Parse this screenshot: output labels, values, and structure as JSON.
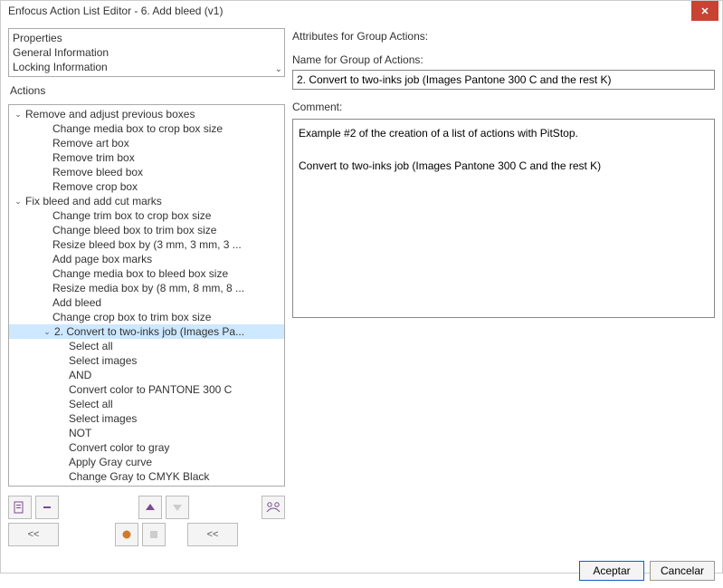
{
  "title": "Enfocus Action List Editor - 6. Add bleed (v1)",
  "infoPanel": {
    "items": [
      "Properties",
      "General Information",
      "Locking Information"
    ]
  },
  "actionsLabel": "Actions",
  "tree": [
    {
      "level": 0,
      "expand": "open",
      "label": "Remove and adjust previous boxes",
      "interact": true
    },
    {
      "level": 2,
      "label": "Change media box to crop box size"
    },
    {
      "level": 2,
      "label": "Remove art box"
    },
    {
      "level": 2,
      "label": "Remove trim box"
    },
    {
      "level": 2,
      "label": "Remove bleed box"
    },
    {
      "level": 2,
      "label": "Remove crop box"
    },
    {
      "level": 0,
      "expand": "open",
      "label": "Fix bleed and add cut marks",
      "interact": true
    },
    {
      "level": 2,
      "label": "Change trim box to crop box size"
    },
    {
      "level": 2,
      "label": "Change bleed box to trim box size"
    },
    {
      "level": 2,
      "label": "Resize bleed box by (3 mm, 3 mm, 3 ..."
    },
    {
      "level": 2,
      "label": "Add page box marks"
    },
    {
      "level": 2,
      "label": "Change media box to bleed box size"
    },
    {
      "level": 2,
      "label": "Resize media box by (8 mm, 8 mm, 8 ..."
    },
    {
      "level": 2,
      "label": "Add bleed"
    },
    {
      "level": 2,
      "label": "Change crop box to trim box size"
    },
    {
      "level": 1,
      "expand": "open",
      "label": "2. Convert to two-inks job (Images Pa...",
      "selected": true,
      "interact": true
    },
    {
      "level": 3,
      "label": "Select all"
    },
    {
      "level": 3,
      "label": "Select images"
    },
    {
      "level": 3,
      "label": "AND"
    },
    {
      "level": 3,
      "label": "Convert color to PANTONE 300 C"
    },
    {
      "level": 3,
      "label": "Select all"
    },
    {
      "level": 3,
      "label": "Select images"
    },
    {
      "level": 3,
      "label": "NOT"
    },
    {
      "level": 3,
      "label": "Convert color to gray"
    },
    {
      "level": 3,
      "label": "Apply Gray curve"
    },
    {
      "level": 3,
      "label": "Change Gray to CMYK Black"
    }
  ],
  "attributes": {
    "heading": "Attributes for Group Actions:",
    "nameLabel": "Name for Group of Actions:",
    "nameValue": "2. Convert to two-inks job (Images Pantone 300 C and the rest K)",
    "commentLabel": "Comment:",
    "commentValue": "Example #2 of the creation of a list of actions with PitStop.\n\nConvert to two-inks job (Images Pantone 300 C and the rest K)"
  },
  "buttons": {
    "accept": "Aceptar",
    "cancel": "Cancelar",
    "navPrev": "<<",
    "navPrev2": "<<"
  },
  "toolbar": {
    "addIcon": "add-action-icon",
    "removeIcon": "remove-action-icon",
    "upIcon": "move-up-icon",
    "downIcon": "move-down-icon",
    "groupIcon": "group-icon",
    "recordIcon": "record-icon",
    "stopIcon": "stop-icon"
  }
}
